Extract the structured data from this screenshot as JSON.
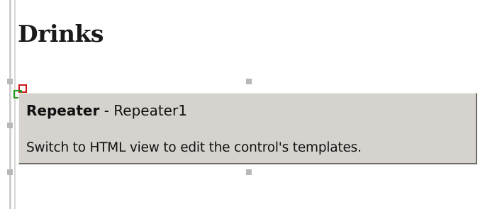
{
  "page": {
    "heading": "Drinks"
  },
  "repeater_control": {
    "type_label": "Repeater",
    "separator": " - ",
    "instance_id": "Repeater1",
    "message": "Switch to HTML view to edit the control's templates."
  },
  "icons": {
    "move_handle": "move-handle-icon"
  },
  "colors": {
    "control_background": "#d6d3ce",
    "handle": "#b8b8b8",
    "move_glyph_red": "#d01818",
    "move_glyph_green": "#1a9a1a"
  }
}
